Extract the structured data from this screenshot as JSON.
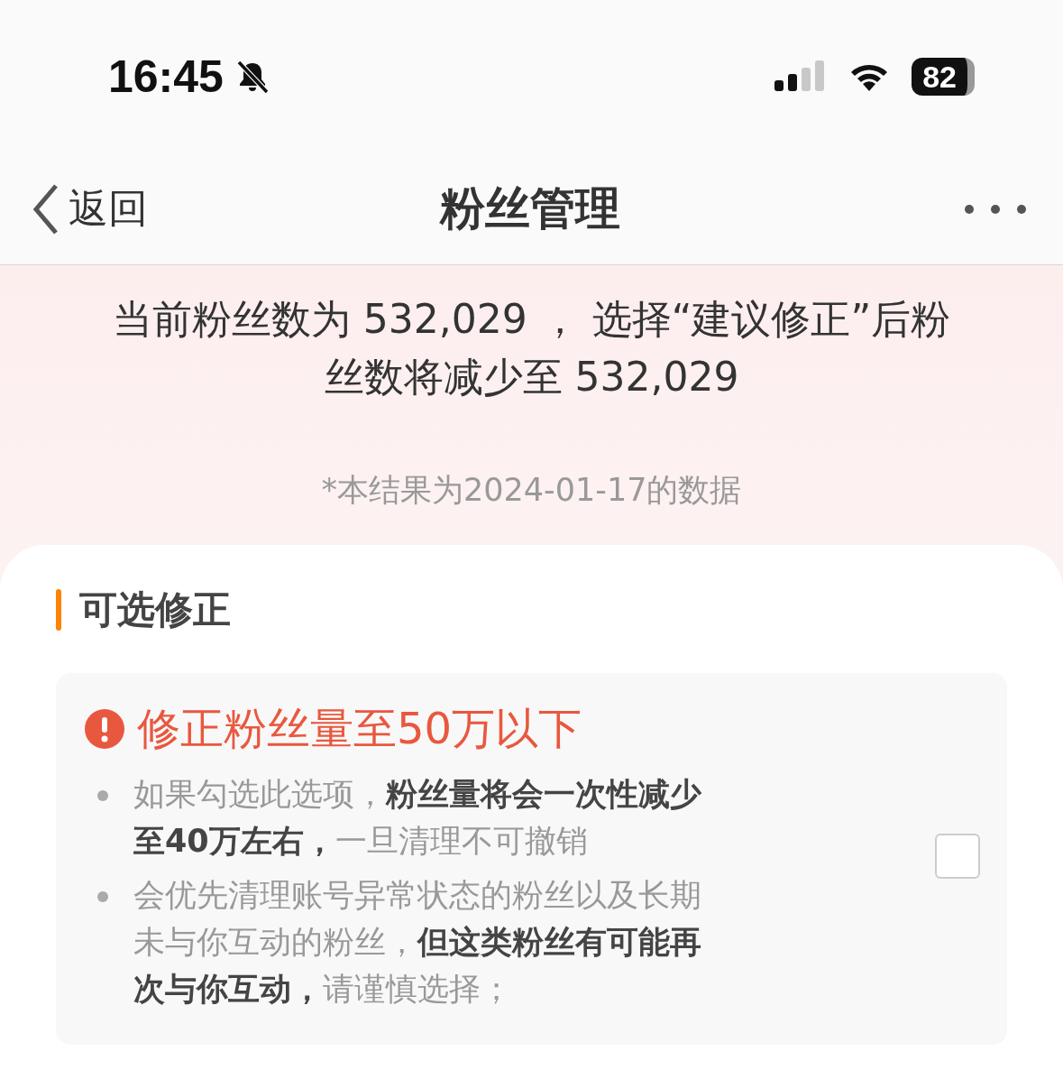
{
  "status_bar": {
    "time": "16:45",
    "silent": true,
    "battery": "82"
  },
  "nav": {
    "back": "返回",
    "title": "粉丝管理"
  },
  "summary": "当前粉丝数为 532,029 ， 选择“建议修正”后粉丝数将减少至 532,029",
  "note": "*本结果为2024-01-17的数据",
  "section": {
    "title": "可选修正",
    "option": {
      "title": "修正粉丝量至50万以下",
      "checked": false,
      "bullets": [
        "如果勾选此选项，**粉丝量将会一次性减少至40万左右，**一旦清理不可撤销",
        "会优先清理账号异常状态的粉丝以及长期未与你互动的粉丝，**但这类粉丝有可能再次与你互动，**请谨慎选择；"
      ]
    }
  }
}
